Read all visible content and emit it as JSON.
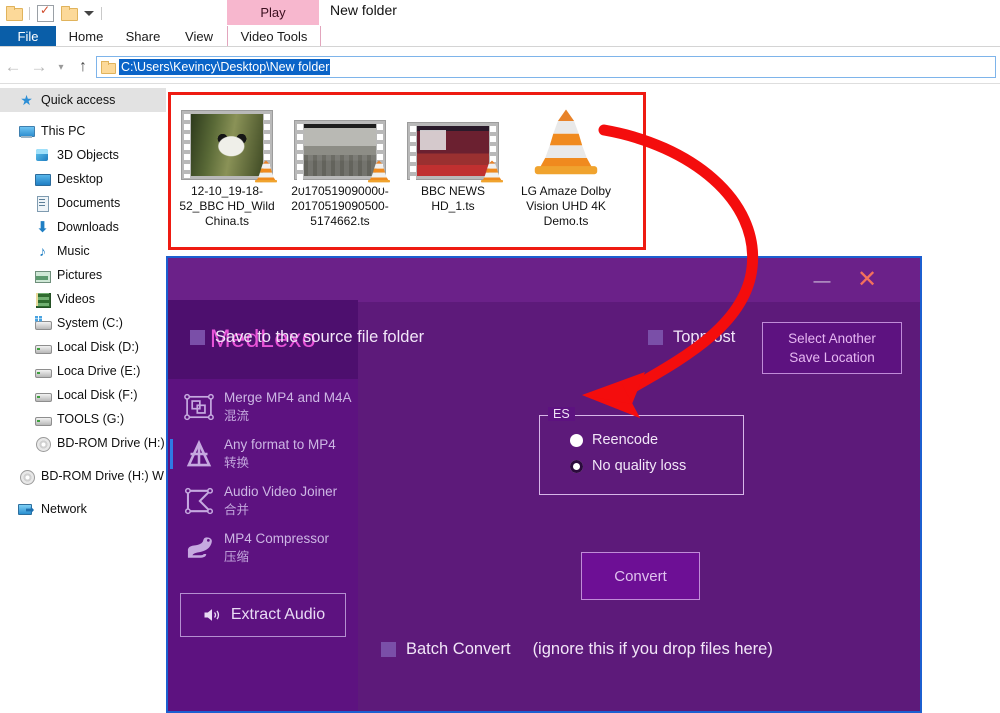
{
  "explorer": {
    "quick_access_toolbar": {
      "icons": [
        "folder-icon",
        "properties-icon",
        "new-folder-icon",
        "customize-caret-icon"
      ]
    },
    "ribbon_tabs": [
      {
        "label": "File"
      },
      {
        "label": "Home"
      },
      {
        "label": "Share"
      },
      {
        "label": "View"
      }
    ],
    "contextual_tab": {
      "header": "Play",
      "tab": "Video Tools"
    },
    "window_title": "New folder",
    "address_bar": {
      "path": "C:\\Users\\Kevincy\\Desktop\\New folder",
      "back_icon": "back-arrow-icon",
      "forward_icon": "forward-arrow-icon",
      "recent_icon": "recent-locations-icon",
      "up_icon": "up-arrow-icon"
    },
    "nav_pane": [
      {
        "label": "Quick access",
        "icon": "star-icon",
        "indent": 0,
        "selected": true
      },
      {
        "label": "This PC",
        "icon": "computer-icon",
        "indent": 0,
        "selected": false
      },
      {
        "label": "3D Objects",
        "icon": "3d-objects-icon",
        "indent": 1,
        "selected": false
      },
      {
        "label": "Desktop",
        "icon": "desktop-icon",
        "indent": 1,
        "selected": false
      },
      {
        "label": "Documents",
        "icon": "documents-icon",
        "indent": 1,
        "selected": false
      },
      {
        "label": "Downloads",
        "icon": "downloads-icon",
        "indent": 1,
        "selected": false
      },
      {
        "label": "Music",
        "icon": "music-icon",
        "indent": 1,
        "selected": false
      },
      {
        "label": "Pictures",
        "icon": "pictures-icon",
        "indent": 1,
        "selected": false
      },
      {
        "label": "Videos",
        "icon": "videos-icon",
        "indent": 1,
        "selected": false
      },
      {
        "label": "System (C:)",
        "icon": "system-drive-icon",
        "indent": 1,
        "selected": false
      },
      {
        "label": "Local Disk (D:)",
        "icon": "drive-icon",
        "indent": 1,
        "selected": false
      },
      {
        "label": "Loca Drive (E:)",
        "icon": "drive-icon",
        "indent": 1,
        "selected": false
      },
      {
        "label": "Local Disk (F:)",
        "icon": "drive-icon",
        "indent": 1,
        "selected": false
      },
      {
        "label": "TOOLS (G:)",
        "icon": "drive-icon",
        "indent": 1,
        "selected": false
      },
      {
        "label": "BD-ROM Drive (H:)",
        "icon": "optical-drive-icon",
        "indent": 1,
        "selected": false
      },
      {
        "label": "BD-ROM Drive (H:) W",
        "icon": "optical-drive-icon",
        "indent": 0,
        "selected": false
      },
      {
        "label": "Network",
        "icon": "network-icon",
        "indent": 0,
        "selected": false
      }
    ],
    "files": [
      {
        "name": "12-10_19-18-52_BBC HD_Wild China.ts",
        "thumb": "panda-video-thumbnail",
        "overlay_icon": "vlc-cone-icon"
      },
      {
        "name": "20170519090000-20170519090500-5174662.ts",
        "thumb": "city-video-thumbnail",
        "overlay_icon": "vlc-cone-icon"
      },
      {
        "name": "BBC NEWS HD_1.ts",
        "thumb": "news-video-thumbnail",
        "overlay_icon": "vlc-cone-icon"
      },
      {
        "name": "LG Amaze Dolby Vision UHD 4K Demo.ts",
        "thumb": "vlc-cone-icon",
        "overlay_icon": ""
      }
    ],
    "annotation": {
      "highlight_box_color": "#ee1b12",
      "arrow_color": "#f40d0d",
      "arrow_name": "red-curved-arrow"
    }
  },
  "medlexo": {
    "brand": "MedLexo",
    "titlebar": {
      "minimize_icon": "minimize-icon",
      "close_icon": "close-icon",
      "accent": "#6b2189"
    },
    "sidebar": [
      {
        "label": "Merge MP4 and M4A",
        "sub": "混流",
        "icon": "merge-icon",
        "active": false
      },
      {
        "label": "Any format to MP4",
        "sub": "转换",
        "icon": "convert-icon",
        "active": true
      },
      {
        "label": "Audio Video Joiner",
        "sub": "合并",
        "icon": "joiner-icon",
        "active": false
      },
      {
        "label": "MP4 Compressor",
        "sub": "压缩",
        "icon": "compressor-icon",
        "active": false
      }
    ],
    "extract_audio": {
      "label": "Extract Audio",
      "icon": "speaker-icon"
    },
    "options": {
      "save_to_source": {
        "label": "Save to the source file folder",
        "checked": false
      },
      "topmost": {
        "label": "Topmost",
        "checked": false
      },
      "select_location_button": {
        "line1": "Select Another",
        "line2": "Save Location"
      }
    },
    "encoder_group": {
      "legend": "ES",
      "options": [
        {
          "label": "Reencode",
          "selected": false
        },
        {
          "label": "No quality loss",
          "selected": true
        }
      ]
    },
    "convert_button": "Convert",
    "batch": {
      "label": "Batch Convert",
      "hint": "(ignore this if you drop files here)",
      "checked": false
    }
  }
}
